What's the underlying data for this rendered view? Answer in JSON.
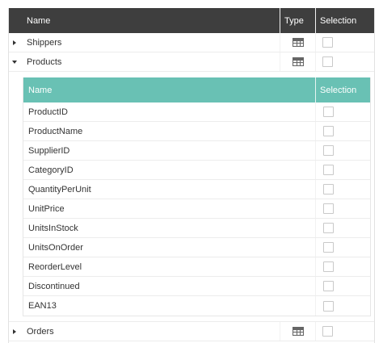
{
  "grid": {
    "headers": {
      "name": "Name",
      "type": "Type",
      "selection": "Selection"
    },
    "rows": [
      {
        "name": "Shippers",
        "expanded": false,
        "type_icon": "table-icon",
        "selected": false
      },
      {
        "name": "Products",
        "expanded": true,
        "type_icon": "table-icon",
        "selected": false
      },
      {
        "name": "Orders",
        "expanded": false,
        "type_icon": "table-icon",
        "selected": false
      }
    ]
  },
  "detail": {
    "headers": {
      "name": "Name",
      "selection": "Selection"
    },
    "columns": [
      {
        "name": "ProductID",
        "selected": false
      },
      {
        "name": "ProductName",
        "selected": false
      },
      {
        "name": "SupplierID",
        "selected": false
      },
      {
        "name": "CategoryID",
        "selected": false
      },
      {
        "name": "QuantityPerUnit",
        "selected": false
      },
      {
        "name": "UnitPrice",
        "selected": false
      },
      {
        "name": "UnitsInStock",
        "selected": false
      },
      {
        "name": "UnitsOnOrder",
        "selected": false
      },
      {
        "name": "ReorderLevel",
        "selected": false
      },
      {
        "name": "Discontinued",
        "selected": false
      },
      {
        "name": "EAN13",
        "selected": false
      }
    ]
  },
  "colors": {
    "header_bg": "#3e3e3e",
    "detail_header_bg": "#69c1b4"
  }
}
